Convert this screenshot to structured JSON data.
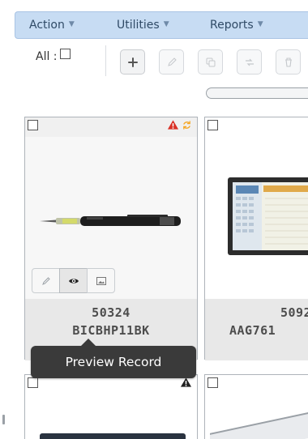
{
  "menubar": {
    "items": [
      {
        "label": "Action"
      },
      {
        "label": "Utilities"
      },
      {
        "label": "Reports"
      }
    ]
  },
  "toolbar": {
    "select_all_label": "All :",
    "buttons": [
      {
        "icon": "plus-icon",
        "enabled": true
      },
      {
        "icon": "pencil-icon",
        "enabled": false
      },
      {
        "icon": "copy-icon",
        "enabled": false
      },
      {
        "icon": "replace-icon",
        "enabled": false
      },
      {
        "icon": "trash-icon",
        "enabled": false
      }
    ]
  },
  "records": [
    {
      "number": "50324",
      "code": "BICBHP11BK",
      "product": "pen",
      "status_icons": [
        "warning-icon",
        "sync-icon"
      ],
      "status_colors": {
        "warning": "#d93025",
        "sync": "#f5a623"
      }
    },
    {
      "number": "5092",
      "code": "AAG761",
      "product": "planner"
    },
    {
      "status_icons": [
        "warning-icon"
      ],
      "status_colors": {
        "warning": "#222222"
      }
    },
    {}
  ],
  "record_actions": [
    {
      "icon": "pencil-icon"
    },
    {
      "icon": "eye-icon",
      "active": true
    },
    {
      "icon": "image-icon"
    }
  ],
  "tooltip": {
    "text": "Preview Record"
  },
  "colors": {
    "menubar_bg": "#c7dcf3",
    "tooltip_bg": "#3a3a3a"
  }
}
